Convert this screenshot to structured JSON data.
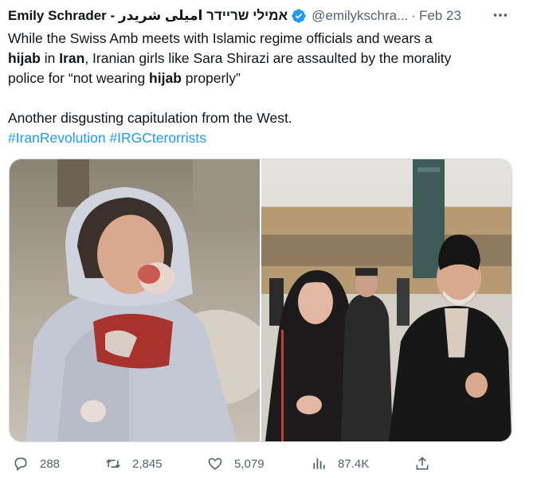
{
  "tweet": {
    "author_name": "Emily Schrader - אמילי שריידר امیلی شریدر",
    "verified_icon": "verified-badge-icon",
    "handle": "@emilykschra...",
    "separator": "·",
    "date": "Feb 23",
    "more_icon": "more-icon",
    "text_line1_a": "While the Swiss Amb meets with Islamic regime officials and wears a",
    "text_bold_hijab": "hijab",
    "text_line2_a": " in ",
    "text_bold_iran": "Iran",
    "text_line2_b": ", Iranian girls like Sara Shirazi are assaulted by the morality",
    "text_line3_a": "police for “not wearing ",
    "text_bold_hijab2": "hijab",
    "text_line3_b": " properly”",
    "text_para2": "Another disgusting capitulation from the West.",
    "hashtag1": "#IranRevolution",
    "hashtag2": "#IRGCterorrists",
    "accent_color": "#1d9bf0",
    "badge_color": "#1d9bf0"
  },
  "media": {
    "left_image": "photo of injured girl in winter coat",
    "right_image": "photo of woman in hijab walking beside cleric"
  },
  "actions": {
    "reply_icon": "reply-icon",
    "reply_count": "288",
    "retweet_icon": "retweet-icon",
    "retweet_count": "2,845",
    "like_icon": "heart-icon",
    "like_count": "5,079",
    "views_icon": "views-icon",
    "views_count": "87.4K",
    "share_icon": "share-icon"
  }
}
